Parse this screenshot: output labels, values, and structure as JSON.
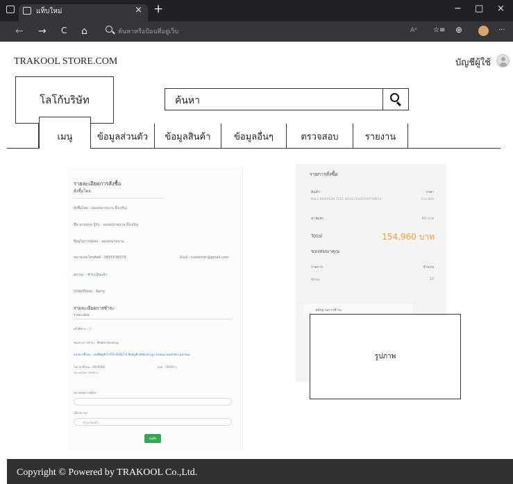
{
  "browser": {
    "tab_title": "แท็บใหม่",
    "tab_close": "×",
    "new_tab": "+",
    "window_controls": {
      "minimize": "−",
      "maximize": "□",
      "close": "×"
    },
    "nav": {
      "back": "←",
      "forward": "→",
      "reload": "C",
      "home": "⌂"
    },
    "address_placeholder": "ค้นหาหรือป้อนที่อยู่เว็บ",
    "toolbar_right": {
      "read_aloud": "Aᵃ",
      "favorites": "☆≡",
      "collections": "⊕",
      "more": "···"
    }
  },
  "header": {
    "site_name": "TRAKOOL STORE.COM",
    "account_label": "บัญชีผู้ใช้",
    "logo_text": "โลโก้บริษัท",
    "search_placeholder": "ค้นหา",
    "search_icon": "search-icon"
  },
  "nav": {
    "tabs": [
      {
        "label": "เมนู"
      },
      {
        "label": "ข้อมูลส่วนตัว"
      },
      {
        "label": "ข้อมูลสินค้า"
      },
      {
        "label": "ข้อมูลอื่นๆ"
      },
      {
        "label": "ตรวจสอบ"
      },
      {
        "label": "รายงาน"
      }
    ]
  },
  "order": {
    "title": "รายละเอียดการสั่งซื้อ",
    "subtitle": "สั่งซื้อโดย",
    "ordered_by": "สั่งซื้อโดย : นมนขนาจนาน อึ้งเจริญ",
    "recipient": "ชื่อ-นามสกุล ผู้รับ : นมนขนาจนาน อึ้งเจริญ",
    "address": "ที่อยู่ในการจัดส่ง : นมนขนาจนาน",
    "phone": "หมายเลขโทรศัพท์ : 0855536578",
    "email": "อีเมล์ : customer@gmail.com",
    "status": "สถานะ : ชำระเงินแล้ว",
    "courier": "บริษัทที่จัดส่ง : Kerry",
    "payment_title": "รายละเอียดการชำระ",
    "payment_subtitle": "รายละเอียด",
    "pay_round": "ครั้งที่ชำระ : 1",
    "pay_channel": "ช่องทางการชำระ : Mobile Banking",
    "pay_account": "ธนาคารที่โอน : เลขที่บัญชี 2-073-45817-6 ชื่อบัญชี บริษัท ตระกูล โทรคมนาคมจำกัด (มหาชน)",
    "pay_date": "วันเวลาที่โอน : 0/0/0000",
    "pay_amount": "ยอด : 00000 บ.",
    "pay_note": "วันเวลาโอน : 00:00 น.",
    "field1_label": "หมายเหตุการจัดส่ง",
    "field2_label": "เลือกสถานะ",
    "field2_value": "ชำระเงินแล้ว",
    "submit": "บันทึก"
  },
  "summary": {
    "title": "รายการสั่งซื้อ",
    "col_product": "สินค้า",
    "col_price": "ราคา",
    "product_name": "DELL INSPIRON 3501 W56615401OPPTHW10",
    "product_price": "154,900",
    "shipping_label": "ค่าจัดส่ง",
    "shipping_value": "60 บาท",
    "total_label": "Total",
    "total_value": "154,960 บาท",
    "gift_title": "ของสมนาคุณ",
    "gift_col_item": "รายการ",
    "gift_col_qty": "จำนวน",
    "gift_item": "พัดลม",
    "gift_qty": "10",
    "proof_label": "หลักฐานการชำระ",
    "photo_label": "รูปภาพ",
    "accent_color": "#f0a030"
  },
  "footer": {
    "text": "Copyright © Powered by TRAKOOL Co.,Ltd."
  }
}
